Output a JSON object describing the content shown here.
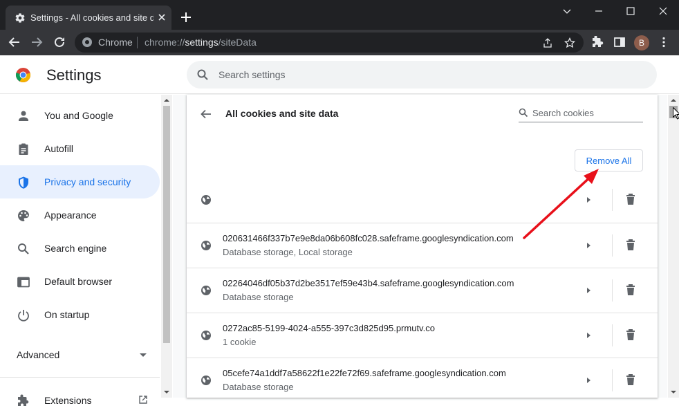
{
  "window": {
    "tab_title": "Settings - All cookies and site data",
    "accent": "#1a73e8",
    "annotation_color": "#e8101a"
  },
  "omnibox": {
    "chip": "Chrome",
    "url_prefix": "chrome://",
    "url_host": "settings",
    "url_path": "/siteData"
  },
  "profile": {
    "initial": "B"
  },
  "header": {
    "title": "Settings",
    "search_placeholder": "Search settings"
  },
  "sidebar": {
    "items": [
      {
        "label": "You and Google",
        "icon": "person-icon"
      },
      {
        "label": "Autofill",
        "icon": "clipboard-icon"
      },
      {
        "label": "Privacy and security",
        "icon": "shield-icon",
        "active": true
      },
      {
        "label": "Appearance",
        "icon": "palette-icon"
      },
      {
        "label": "Search engine",
        "icon": "search-icon"
      },
      {
        "label": "Default browser",
        "icon": "browser-icon"
      },
      {
        "label": "On startup",
        "icon": "power-icon"
      }
    ],
    "advanced_label": "Advanced",
    "extensions_label": "Extensions"
  },
  "card": {
    "title": "All cookies and site data",
    "search_placeholder": "Search cookies",
    "remove_all_label": "Remove All",
    "rows": [
      {
        "name": "",
        "detail": ""
      },
      {
        "name": "020631466f337b7e9e8da06b608fc028.safeframe.googlesyndication.com",
        "detail": "Database storage, Local storage"
      },
      {
        "name": "02264046df05b37d2be3517ef59e43b4.safeframe.googlesyndication.com",
        "detail": "Database storage"
      },
      {
        "name": "0272ac85-5199-4024-a555-397c3d825d95.prmutv.co",
        "detail": "1 cookie"
      },
      {
        "name": "05cefe74a1ddf7a58622f1e22fe72f69.safeframe.googlesyndication.com",
        "detail": "Database storage"
      }
    ]
  }
}
